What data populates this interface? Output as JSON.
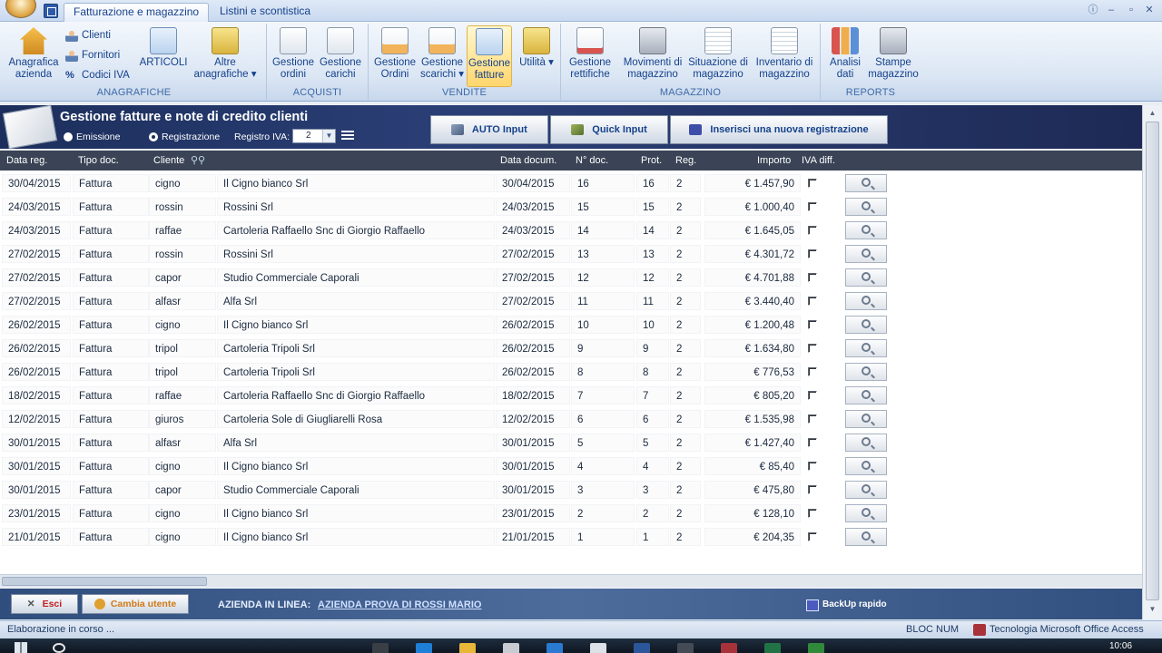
{
  "ribbon": {
    "tabs": [
      "Fatturazione e magazzino",
      "Listini e scontistica"
    ],
    "window_controls": [
      "ⓘ",
      "–",
      "▫",
      "✕"
    ],
    "groups": {
      "anagrafiche": {
        "label": "ANAGRAFICHE",
        "anagrafica_azienda": "Anagrafica azienda",
        "clienti": "Clienti",
        "fornitori": "Fornitori",
        "codici_iva": "Codici IVA",
        "articoli": "ARTICOLI",
        "altre_anagrafiche": "Altre anagrafiche ▾"
      },
      "acquisti": {
        "label": "ACQUISTI",
        "gestione_ordini": "Gestione ordini",
        "gestione_carichi": "Gestione carichi"
      },
      "vendite": {
        "label": "VENDITE",
        "gestione_ordini": "Gestione Ordini",
        "gestione_scarichi": "Gestione scarichi ▾",
        "gestione_fatture": "Gestione fatture",
        "utilita": "Utilità ▾"
      },
      "magazzino": {
        "label": "MAGAZZINO",
        "gestione_rettifiche": "Gestione rettifiche",
        "movimenti_magazzino": "Movimenti di magazzino",
        "situazione_magazzino": "Situazione di magazzino",
        "inventario_magazzino": "Inventario di magazzino"
      },
      "reports": {
        "label": "REPORTS",
        "analisi_dati": "Analisi dati",
        "stampe_magazzino": "Stampe magazzino"
      }
    }
  },
  "form": {
    "title": "Gestione fatture e note di credito clienti",
    "radio_emissione": "Emissione",
    "radio_registrazione": "Registrazione",
    "selected_radio": "Registrazione",
    "registro_label": "Registro IVA:",
    "registro_value": "2",
    "auto_input": "AUTO Input",
    "quick_input": "Quick Input",
    "new_registration": "Inserisci una nuova registrazione"
  },
  "table": {
    "headers": {
      "data_reg": "Data reg.",
      "tipo_doc": "Tipo doc.",
      "cliente": "Cliente",
      "data_docum": "Data docum.",
      "n_doc": "N° doc.",
      "prot": "Prot.",
      "reg": "Reg.",
      "importo": "Importo",
      "iva_diff": "IVA diff."
    },
    "rows": [
      {
        "data_reg": "30/04/2015",
        "tipo": "Fattura",
        "codice": "cigno",
        "ragione": "Il Cigno bianco Srl",
        "data_doc": "30/04/2015",
        "n_doc": "16",
        "prot": "16",
        "reg": "2",
        "importo": "€ 1.457,90"
      },
      {
        "data_reg": "24/03/2015",
        "tipo": "Fattura",
        "codice": "rossin",
        "ragione": "Rossini Srl",
        "data_doc": "24/03/2015",
        "n_doc": "15",
        "prot": "15",
        "reg": "2",
        "importo": "€ 1.000,40"
      },
      {
        "data_reg": "24/03/2015",
        "tipo": "Fattura",
        "codice": "raffae",
        "ragione": "Cartoleria Raffaello Snc di Giorgio Raffaello",
        "data_doc": "24/03/2015",
        "n_doc": "14",
        "prot": "14",
        "reg": "2",
        "importo": "€ 1.645,05"
      },
      {
        "data_reg": "27/02/2015",
        "tipo": "Fattura",
        "codice": "rossin",
        "ragione": "Rossini Srl",
        "data_doc": "27/02/2015",
        "n_doc": "13",
        "prot": "13",
        "reg": "2",
        "importo": "€ 4.301,72"
      },
      {
        "data_reg": "27/02/2015",
        "tipo": "Fattura",
        "codice": "capor",
        "ragione": "Studio Commerciale Caporali",
        "data_doc": "27/02/2015",
        "n_doc": "12",
        "prot": "12",
        "reg": "2",
        "importo": "€ 4.701,88"
      },
      {
        "data_reg": "27/02/2015",
        "tipo": "Fattura",
        "codice": "alfasr",
        "ragione": "Alfa Srl",
        "data_doc": "27/02/2015",
        "n_doc": "11",
        "prot": "11",
        "reg": "2",
        "importo": "€ 3.440,40"
      },
      {
        "data_reg": "26/02/2015",
        "tipo": "Fattura",
        "codice": "cigno",
        "ragione": "Il Cigno bianco Srl",
        "data_doc": "26/02/2015",
        "n_doc": "10",
        "prot": "10",
        "reg": "2",
        "importo": "€ 1.200,48"
      },
      {
        "data_reg": "26/02/2015",
        "tipo": "Fattura",
        "codice": "tripol",
        "ragione": "Cartoleria Tripoli Srl",
        "data_doc": "26/02/2015",
        "n_doc": "9",
        "prot": "9",
        "reg": "2",
        "importo": "€ 1.634,80"
      },
      {
        "data_reg": "26/02/2015",
        "tipo": "Fattura",
        "codice": "tripol",
        "ragione": "Cartoleria Tripoli Srl",
        "data_doc": "26/02/2015",
        "n_doc": "8",
        "prot": "8",
        "reg": "2",
        "importo": "€ 776,53"
      },
      {
        "data_reg": "18/02/2015",
        "tipo": "Fattura",
        "codice": "raffae",
        "ragione": "Cartoleria Raffaello Snc di Giorgio Raffaello",
        "data_doc": "18/02/2015",
        "n_doc": "7",
        "prot": "7",
        "reg": "2",
        "importo": "€ 805,20"
      },
      {
        "data_reg": "12/02/2015",
        "tipo": "Fattura",
        "codice": "giuros",
        "ragione": "Cartoleria Sole di Giugliarelli Rosa",
        "data_doc": "12/02/2015",
        "n_doc": "6",
        "prot": "6",
        "reg": "2",
        "importo": "€ 1.535,98"
      },
      {
        "data_reg": "30/01/2015",
        "tipo": "Fattura",
        "codice": "alfasr",
        "ragione": "Alfa Srl",
        "data_doc": "30/01/2015",
        "n_doc": "5",
        "prot": "5",
        "reg": "2",
        "importo": "€ 1.427,40"
      },
      {
        "data_reg": "30/01/2015",
        "tipo": "Fattura",
        "codice": "cigno",
        "ragione": "Il Cigno bianco Srl",
        "data_doc": "30/01/2015",
        "n_doc": "4",
        "prot": "4",
        "reg": "2",
        "importo": "€ 85,40"
      },
      {
        "data_reg": "30/01/2015",
        "tipo": "Fattura",
        "codice": "capor",
        "ragione": "Studio Commerciale Caporali",
        "data_doc": "30/01/2015",
        "n_doc": "3",
        "prot": "3",
        "reg": "2",
        "importo": "€ 475,80"
      },
      {
        "data_reg": "23/01/2015",
        "tipo": "Fattura",
        "codice": "cigno",
        "ragione": "Il Cigno bianco Srl",
        "data_doc": "23/01/2015",
        "n_doc": "2",
        "prot": "2",
        "reg": "2",
        "importo": "€ 128,10"
      },
      {
        "data_reg": "21/01/2015",
        "tipo": "Fattura",
        "codice": "cigno",
        "ragione": "Il Cigno bianco Srl",
        "data_doc": "21/01/2015",
        "n_doc": "1",
        "prot": "1",
        "reg": "2",
        "importo": "€ 204,35"
      }
    ]
  },
  "footer": {
    "esci": "Esci",
    "cambia_utente": "Cambia utente",
    "azienda_label": "AZIENDA IN LINEA:",
    "azienda_name": "AZIENDA PROVA DI ROSSI MARIO",
    "backup": "BackUp rapido"
  },
  "status": {
    "left": "Elaborazione in corso ...",
    "num": "BLOC NUM",
    "tech": "Tecnologia Microsoft Office Access"
  },
  "taskbar": {
    "clock": "10:06"
  },
  "colors": {
    "accent": "#15428b",
    "header_bg": "#1c2f5c",
    "grid_header": "#3a4456",
    "footer_bg": "#4d6c9c"
  }
}
